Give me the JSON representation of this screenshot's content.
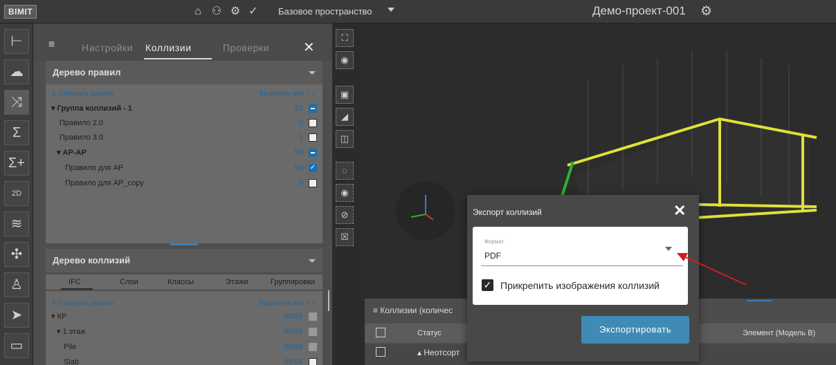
{
  "topbar": {
    "logo": "BIMIT",
    "space": "Базовое пространство",
    "project": "Демо-проект-001"
  },
  "panel": {
    "tabs": [
      "Настройки",
      "Коллизии",
      "Проверки"
    ],
    "rules": {
      "title": "Дерево правил",
      "collapse": "Свернуть дерево",
      "select_all": "Выделить всё",
      "items": [
        {
          "label": "Группа коллизий - 1",
          "count": "57"
        },
        {
          "label": "Правило 2.0",
          "count": "0"
        },
        {
          "label": "Правило 3.0",
          "count": "1"
        },
        {
          "label": "АР-АР",
          "count": "56"
        },
        {
          "label": "Правило для АР",
          "count": "56"
        },
        {
          "label": "Правило для АР_copy",
          "count": "0"
        }
      ]
    },
    "collisions": {
      "title": "Дерево коллизий",
      "subtabs": [
        "IFC",
        "Слои",
        "Классы",
        "Этажи",
        "Группировки"
      ],
      "collapse": "Свернуть дерево",
      "select_all": "Выделить всё",
      "items": [
        {
          "label": "КР",
          "count": "56/56"
        },
        {
          "label": "1 этаж",
          "count": "56/56"
        },
        {
          "label": "Pile",
          "count": "56/56"
        },
        {
          "label": "Slab",
          "count": "56/56"
        }
      ]
    }
  },
  "grid": {
    "title": "Коллизии (количес",
    "col_status": "Статус",
    "col_b": "Элемент (Модель B)",
    "row1": "Неотсорт"
  },
  "modal": {
    "title": "Экспорт коллизий",
    "format_label": "Формат",
    "format_value": "PDF",
    "attach_label": "Прикрепить изображения коллизий",
    "export": "Экспортировать"
  },
  "colors": {
    "accent": "#3f8bb5",
    "checkbox": "#1c6fae",
    "model": "#e0e03a"
  }
}
